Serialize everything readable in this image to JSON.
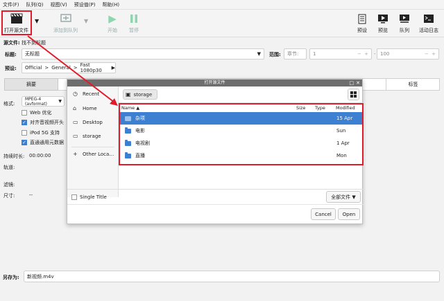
{
  "menu": [
    "文件(F)",
    "队列(Q)",
    "视图(V)",
    "预设值(P)",
    "帮助(H)"
  ],
  "toolbar": {
    "open_source": "打开源文件",
    "add_queue": "添加到队列",
    "start": "开始",
    "pause": "暂停",
    "presets": "预设",
    "preview": "预览",
    "queue": "队列",
    "activity": "活动日志"
  },
  "source": {
    "label": "源文件:",
    "value": "找不到标题"
  },
  "title": {
    "label": "标题:",
    "value": "无标题"
  },
  "range": {
    "label": "范围:",
    "type": "章节:",
    "start": "1",
    "end": "100"
  },
  "preset": {
    "label": "预设:",
    "crumbs": [
      "Official",
      ">",
      "General",
      ">",
      "Fast 1080p30"
    ]
  },
  "tabs": {
    "summary": "摘要",
    "tags": "标签"
  },
  "format": {
    "label": "格式:",
    "value": "MPEG-4 (avformat)",
    "web_opt": "Web 优化",
    "align_av": "对齐音视频开头",
    "ipod": "iPod 5G 支持",
    "passthru": "直通通用元数据"
  },
  "info": {
    "duration_label": "持续时长:",
    "duration_value": "00:00:00",
    "tracks_label": "轨道:",
    "filters_label": "滤镜:",
    "size_label": "尺寸:",
    "size_value": "--"
  },
  "saveas": {
    "label": "另存为:",
    "value": "新视频.m4v"
  },
  "dialog": {
    "title": "打开源文件",
    "path": "storage",
    "side": [
      "Recent",
      "Home",
      "Desktop",
      "storage",
      "Other Loca…"
    ],
    "cols": {
      "name": "Name",
      "size": "Size",
      "type": "Type",
      "modified": "Modified"
    },
    "rows": [
      {
        "name": "杂项",
        "modified": "15 Apr"
      },
      {
        "name": "电影",
        "modified": "Sun"
      },
      {
        "name": "电视剧",
        "modified": "1 Apr"
      },
      {
        "name": "直播",
        "modified": "Mon"
      }
    ],
    "single_title": "Single Title",
    "filter": "全部文件",
    "cancel": "Cancel",
    "open": "Open"
  },
  "colors": {
    "accent": "#3d7fd0",
    "annotation": "#e11b2a"
  }
}
